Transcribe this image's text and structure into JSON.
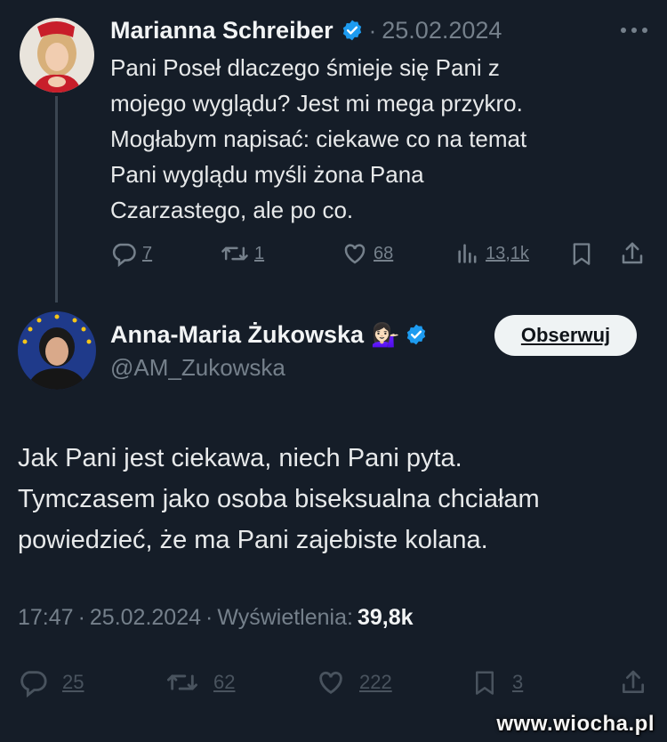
{
  "reply": {
    "author": "Marianna Schreiber",
    "date": "25.02.2024",
    "text_lines": [
      "Pani Poseł dlaczego śmieje się Pani z",
      "mojego wyglądu? Jest mi mega przykro.",
      "Mogłabym napisać: ciekawe co na temat",
      "Pani wyglądu myśli żona Pana",
      "Czarzastego, ale po co."
    ],
    "replies": "7",
    "retweets": "1",
    "likes": "68",
    "views": "13,1k"
  },
  "main": {
    "author": "Anna-Maria Żukowska",
    "emoji": "💁🏻‍♀️",
    "handle": "@AM_Zukowska",
    "follow_label": "Obserwuj",
    "text_lines": [
      "Jak Pani jest ciekawa, niech Pani pyta.",
      "Tymczasem jako osoba biseksualna chciałam",
      "powiedzieć, że ma Pani zajebiste kolana."
    ],
    "time": "17:47",
    "date": "25.02.2024",
    "views_label": "Wyświetlenia:",
    "views": "39,8k",
    "replies": "25",
    "retweets": "62",
    "likes": "222",
    "bookmarks": "3"
  },
  "watermark": "www.wiocha.pl",
  "colors": {
    "verified": "#1d9bf0",
    "background": "#151d28",
    "muted": "#75808b"
  }
}
